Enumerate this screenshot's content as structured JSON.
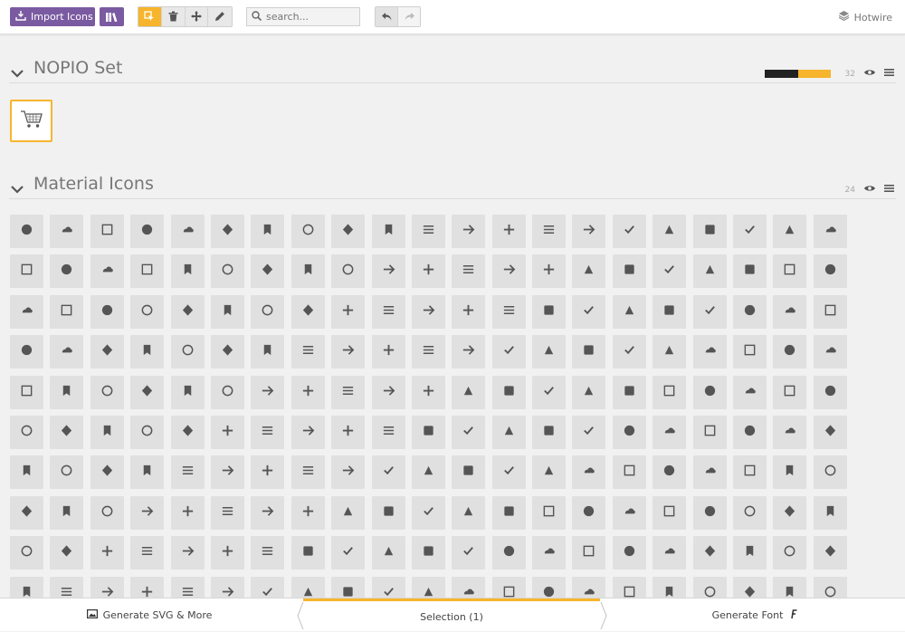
{
  "toolbar": {
    "import_label": "Import Icons",
    "search_placeholder": "search...",
    "project_name": "Hotwire"
  },
  "sets": [
    {
      "title": "NOPIO Set",
      "count": "32"
    },
    {
      "title": "Material Icons",
      "count": "24"
    }
  ],
  "bottom": {
    "generate_svg": "Generate SVG & More",
    "selection": "Selection (1)",
    "generate_font": "Generate Font"
  },
  "colors": {
    "accent": "#f6b52c",
    "purple": "#7a5aa0",
    "tile": "#e0e0e0"
  },
  "icons": [
    "3d-rotation",
    "ac-unit",
    "access-alarm",
    "access-alarms",
    "access-time",
    "accessibility",
    "accessible",
    "account-balance",
    "account-balance-wallet",
    "account-box",
    "account-circle",
    "adb",
    "add",
    "add-a-photo",
    "add-alarm",
    "add-alert",
    "add-box",
    "add-circle",
    "add-circle-outline",
    "add-location",
    "add-shopping-cart",
    "add-to-photos",
    "add-to-queue",
    "adjust",
    "airline-seat-flat",
    "airline-seat-flat-angled",
    "airline-seat-individual-suite",
    "airline-seat-legroom-extra",
    "airline-seat-legroom-normal",
    "airline-seat-legroom-reduced",
    "airline-seat-recline-extra",
    "airline-seat-recline-normal",
    "airplanemode-active",
    "airplanemode-inactive",
    "airplay",
    "airport-shuttle",
    "alarm-off",
    "alarm-on",
    "album",
    "all-inclusive",
    "all-out",
    "android",
    "announcement",
    "apps",
    "archive",
    "arrow-back",
    "arrow-downward",
    "arrow-drop-down",
    "arrow-drop-down-circle",
    "arrow-drop-up",
    "arrow-forward",
    "arrow-upward",
    "art-track",
    "aspect-ratio",
    "assessment",
    "assignment",
    "assignment-ind",
    "assignment-late",
    "assignment-return",
    "assignment-returned",
    "assignment-turned-in",
    "assistant",
    "assistant-photo",
    "attach-file",
    "attach-money",
    "attachment",
    "audiotrack",
    "autorenew",
    "av-timer",
    "backspace",
    "backup",
    "battery-alert",
    "battery-charging-full",
    "battery-full",
    "battery-std",
    "beach-access",
    "beenhere",
    "block",
    "bluetooth",
    "bluetooth-audio",
    "bluetooth-connected",
    "bluetooth-disabled",
    "bluetooth-searching",
    "blur-circular",
    "blur-linear",
    "blur-off",
    "blur-on",
    "book",
    "bookmark",
    "bookmark-border",
    "border-all",
    "border-bottom",
    "border-clear",
    "border-color",
    "border-horizontal",
    "border-inner",
    "border-left",
    "border-outer",
    "border-right",
    "border-style",
    "border-top",
    "border-vertical",
    "branding-watermark",
    "brightness-1",
    "brightness-2",
    "brightness-3",
    "brightness-4",
    "brightness-5",
    "brightness-6",
    "brightness-7",
    "brightness-auto",
    "broken-image",
    "brush",
    "bubble-chart",
    "bug-report",
    "build",
    "burst-mode",
    "business",
    "business-center",
    "cached",
    "cake",
    "call",
    "call-end",
    "call-made",
    "call-merge",
    "call-missed",
    "call-missed-outgoing",
    "call-received",
    "call-split",
    "call-to-action",
    "camera",
    "camera-alt",
    "camera-enhance",
    "camera-front",
    "camera-rear",
    "camera-roll",
    "cancel",
    "card-giftcard",
    "card-membership",
    "card-travel",
    "casino",
    "cast",
    "cast-connected",
    "center-focus-strong",
    "center-focus-weak",
    "change-history",
    "chat",
    "chat-bubble",
    "chat-bubble-outline",
    "check",
    "check-box",
    "check-box-outline-blank",
    "check-circle",
    "chevron-left",
    "chevron-right",
    "child-care",
    "child-friendly",
    "chrome-reader-mode",
    "class",
    "clear",
    "clear-all",
    "closed-caption",
    "cloud",
    "cloud-circle",
    "cloud-done",
    "cloud-download",
    "cloud-off",
    "cloud-queue",
    "code",
    "collections",
    "collections-bookmark",
    "color-lens",
    "colorize",
    "comment",
    "compare",
    "compare-arrows",
    "computer",
    "confirmation-number",
    "contact-mail",
    "contact-phone",
    "contacts",
    "content-copy",
    "content-cut",
    "content-paste",
    "control-point",
    "control-point-duplicate",
    "copyright",
    "create",
    "create-new-folder",
    "credit-card",
    "crop",
    "crop-16-9",
    "crop-3-2",
    "crop-5-4",
    "crop-7-5",
    "crop-din",
    "crop-free",
    "crop-landscape",
    "crop-original",
    "crop-portrait",
    "crop-rotate",
    "crop-square",
    "dashboard",
    "data-usage",
    "date-range",
    "dehaze",
    "delete",
    "delete-forever",
    "delete-sweep",
    "description"
  ]
}
